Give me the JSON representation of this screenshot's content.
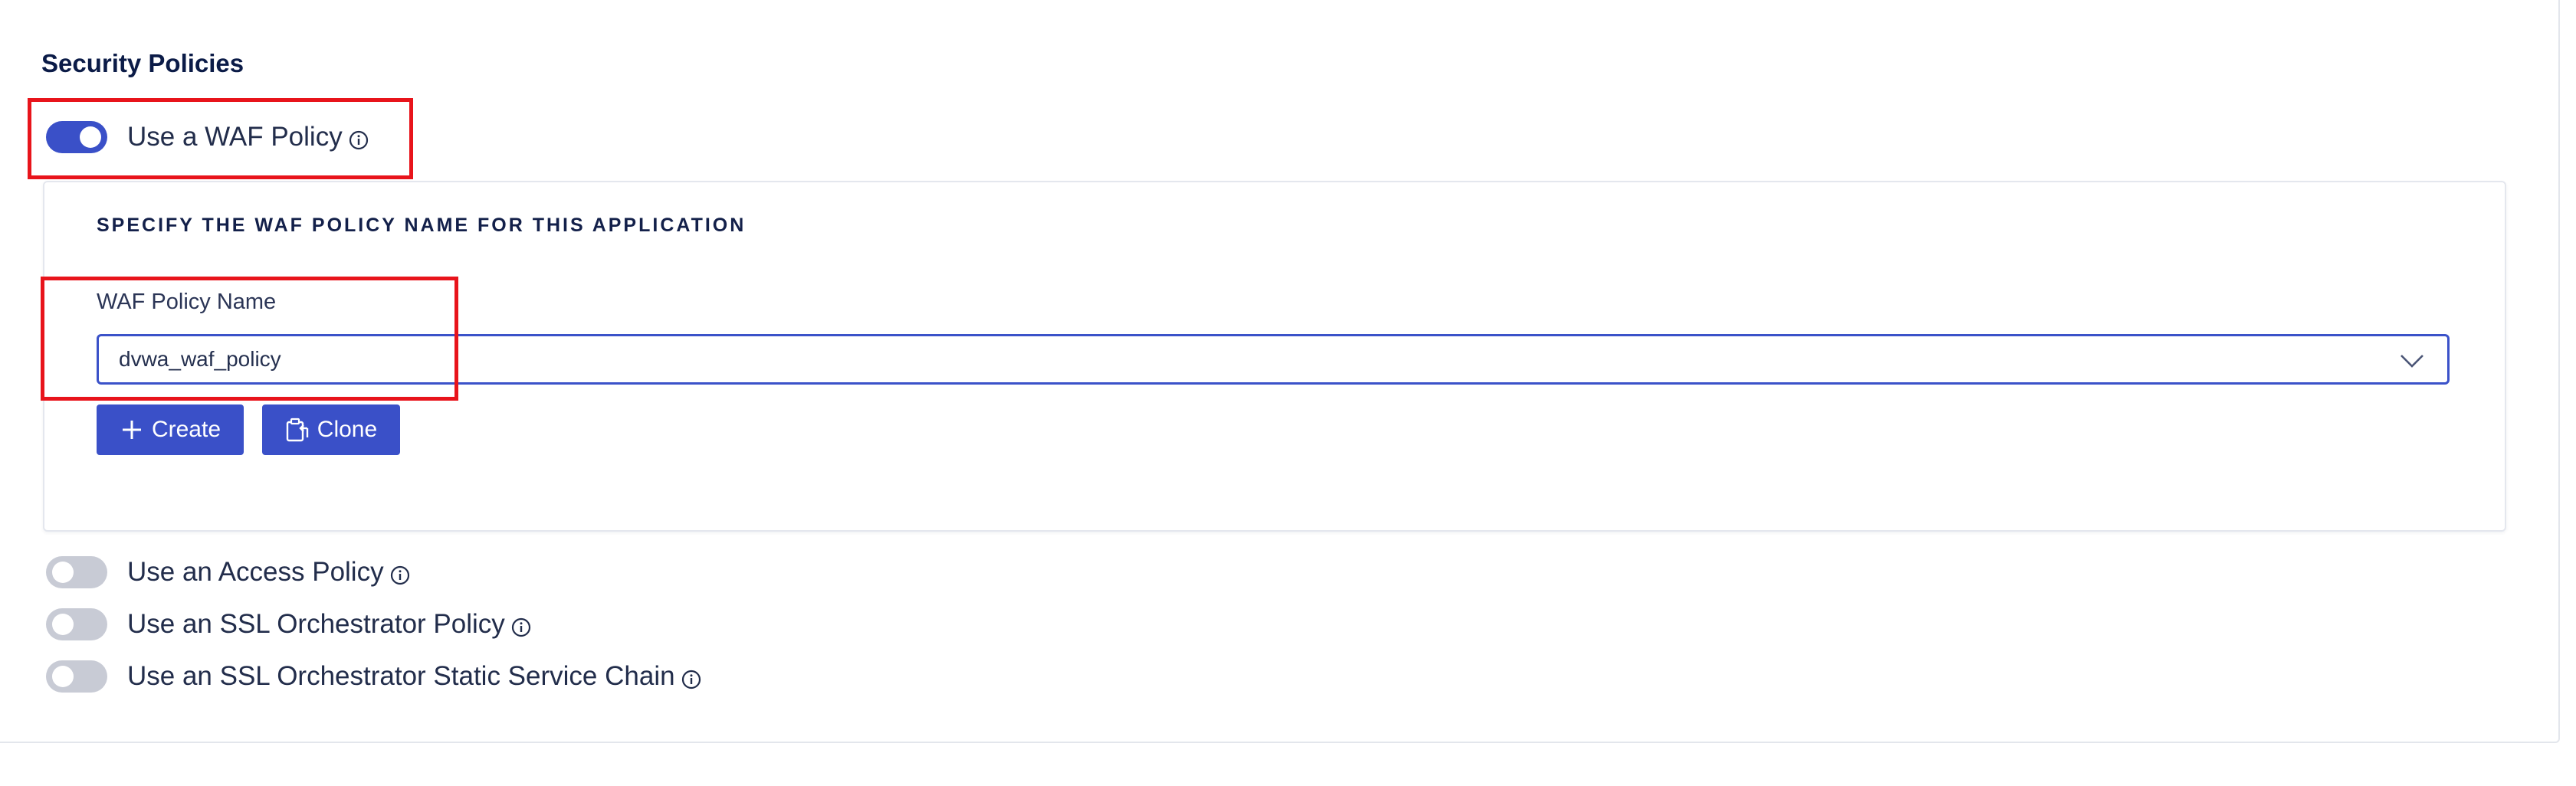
{
  "section": {
    "title": "Security Policies"
  },
  "waf": {
    "toggle_label": "Use a WAF Policy",
    "enabled": true,
    "panel_heading": "SPECIFY THE WAF POLICY NAME FOR THIS APPLICATION",
    "field_label": "WAF Policy Name",
    "field_value": "dvwa_waf_policy",
    "create_label": "Create",
    "clone_label": "Clone"
  },
  "other_policies": [
    {
      "label": "Use an Access Policy",
      "enabled": false
    },
    {
      "label": "Use an SSL Orchestrator Policy",
      "enabled": false
    },
    {
      "label": "Use an SSL Orchestrator Static Service Chain",
      "enabled": false
    }
  ],
  "colors": {
    "accent": "#3a50c8",
    "toggle_off": "#c8cbd5",
    "highlight": "#e8141b",
    "title": "#0b1b47"
  },
  "icons": {
    "info": "info-circle-icon",
    "chevron": "chevron-down-icon",
    "plus": "plus-icon",
    "clone": "clone-icon"
  }
}
